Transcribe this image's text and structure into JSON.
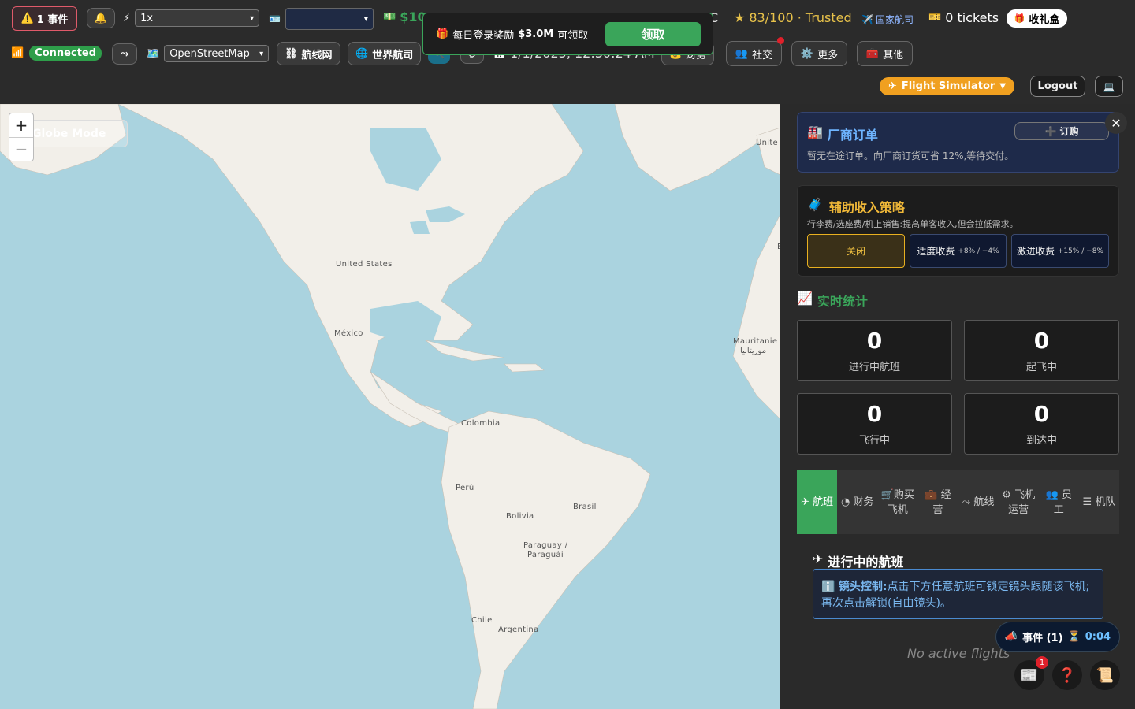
{
  "top": {
    "events_badge": "1 事件",
    "speed": "1x",
    "money": "$10",
    "connection": "Connected",
    "map_style": "OpenStreetMap",
    "route_network": "航线网",
    "world_airlines": "世界航司",
    "datetime": "1/1/2025, 12:30:24 AM",
    "finance": "财务",
    "utc_fragment": "C",
    "trust": "83/100 · Trusted",
    "national_airline": "国家航司",
    "tickets": "0 tickets",
    "inbox": "收礼盒",
    "social": "社交",
    "more": "更多",
    "other": "其他",
    "simulator": "Flight Simulator",
    "logout": "Logout"
  },
  "toast": {
    "prefix": "每日登录奖励",
    "amount": "$3.0M",
    "suffix": "可领取",
    "claim": "领取"
  },
  "map": {
    "globe_mode": "Globe Mode",
    "zoom_in": "+",
    "zoom_out": "−",
    "labels": {
      "us": "United States",
      "mexico": "México",
      "colombia": "Colombia",
      "peru": "Perú",
      "bolivia": "Bolivia",
      "brasil": "Brasil",
      "paraguay1": "Paraguay /",
      "paraguay2": "Paraguái",
      "chile": "Chile",
      "argentina": "Argentina",
      "mauritanie": "Mauritanie",
      "mauritanie_ar": "موريتانيا",
      "united": "Unite",
      "edge_e": "E"
    }
  },
  "panel": {
    "factory": {
      "title": "厂商订单",
      "order_button": "订购",
      "desc": "暂无在途订单。向厂商订货可省 12%,等待交付。"
    },
    "ancillary": {
      "title": "辅助收入策略",
      "desc": "行李费/选座费/机上销售:提高单客收入,但会拉低需求。",
      "options": [
        {
          "label": "关闭",
          "sub": ""
        },
        {
          "label": "适度收费",
          "sub": "+8% / −4%"
        },
        {
          "label": "激进收费",
          "sub": "+15% / −8%"
        }
      ]
    },
    "stats_title": "实时统计",
    "stats": [
      {
        "value": "0",
        "label": "进行中航班"
      },
      {
        "value": "0",
        "label": "起飞中"
      },
      {
        "value": "0",
        "label": "飞行中"
      },
      {
        "value": "0",
        "label": "到达中"
      }
    ],
    "tabs": [
      "航班",
      "财务",
      "购买飞机",
      "经营",
      "航线",
      "飞机运营",
      "员工",
      "机队"
    ],
    "active_flights_title": "进行中的航班",
    "info_bold": "镜头控制:",
    "info_text": "点击下方任意航班可锁定镜头跟随该飞机;再次点击解锁(自由镜头)。",
    "no_flights": "No active flights",
    "event_pill": "事件 (1)",
    "event_timer": "0:04",
    "news_badge": "1"
  },
  "colors": {
    "accent": "#3aa55a",
    "warning": "#f0a020",
    "gold": "#e8c24a"
  }
}
